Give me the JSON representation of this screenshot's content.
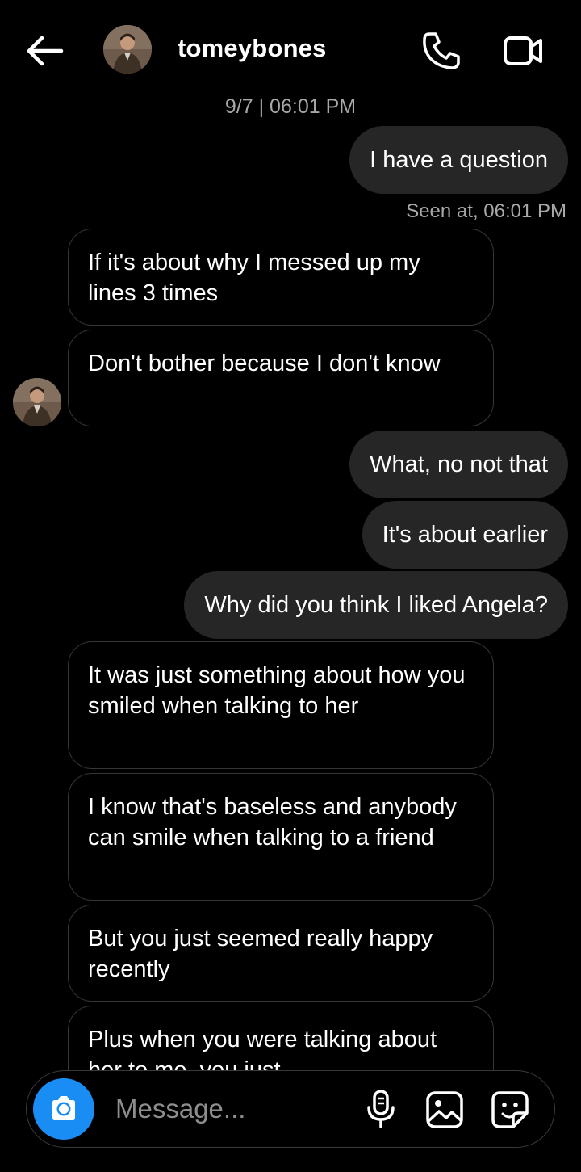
{
  "header": {
    "username": "tomeybones",
    "icons": {
      "back": "arrow-left-icon",
      "call": "phone-icon",
      "video": "video-camera-icon"
    }
  },
  "chat": {
    "timestamp": "9/7 | 06:01 PM",
    "seen": "Seen at, 06:01 PM",
    "messages": [
      {
        "from": "me",
        "text": "I have a question"
      },
      {
        "from": "them",
        "text": "If it's about why I messed up my lines 3 times"
      },
      {
        "from": "them",
        "text": "Don't bother because I don't know"
      },
      {
        "from": "me",
        "text": "What, no not that"
      },
      {
        "from": "me",
        "text": "It's about earlier"
      },
      {
        "from": "me",
        "text": "Why did you think I liked Angela?"
      },
      {
        "from": "them",
        "text": "It was just something about how you smiled when talking to her"
      },
      {
        "from": "them",
        "text": "I know that's baseless and anybody can smile when talking to a friend"
      },
      {
        "from": "them",
        "text": "But you just seemed really happy recently"
      },
      {
        "from": "them",
        "text": "Plus when you were talking about her to me, you just"
      }
    ]
  },
  "composer": {
    "placeholder": "Message...",
    "icons": {
      "camera": "camera-icon",
      "mic": "microphone-icon",
      "gallery": "image-icon",
      "sticker": "sticker-icon"
    }
  },
  "colors": {
    "background": "#000000",
    "outgoing_bubble": "#262626",
    "incoming_border": "#363636",
    "camera_button": "#1a8df5",
    "secondary_text": "#a8a8a8"
  }
}
